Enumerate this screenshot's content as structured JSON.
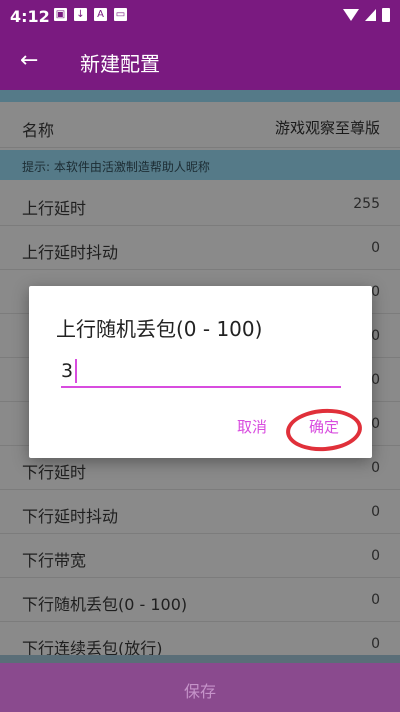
{
  "status_bar": {
    "time": "4:12"
  },
  "app_bar": {
    "back_icon": "arrow-left-icon",
    "title": "新建配置"
  },
  "name_row": {
    "label": "名称",
    "value": "游戏观察至尊版"
  },
  "hint": "提示: 本软件由活激制造帮助人昵称",
  "rows": [
    {
      "label": "上行延时",
      "value": "255"
    },
    {
      "label": "上行延时抖动",
      "value": "0"
    },
    {
      "label": "",
      "value": "0"
    },
    {
      "label": "",
      "value": "0"
    },
    {
      "label": "",
      "value": "0"
    },
    {
      "label": "",
      "value": "0"
    },
    {
      "label": "下行延时",
      "value": "0"
    },
    {
      "label": "下行延时抖动",
      "value": "0"
    },
    {
      "label": "下行带宽",
      "value": "0"
    },
    {
      "label": "下行随机丢包(0 - 100)",
      "value": "0"
    },
    {
      "label": "下行连续丢包(放行)",
      "value": "0"
    }
  ],
  "save_button": "保存",
  "dialog": {
    "title": "上行随机丢包(0 - 100)",
    "input_value": "3",
    "cancel": "取消",
    "confirm": "确定"
  },
  "colors": {
    "primary": "#7a1a80",
    "accent": "#d84cdf",
    "annotation": "#e0303a"
  }
}
